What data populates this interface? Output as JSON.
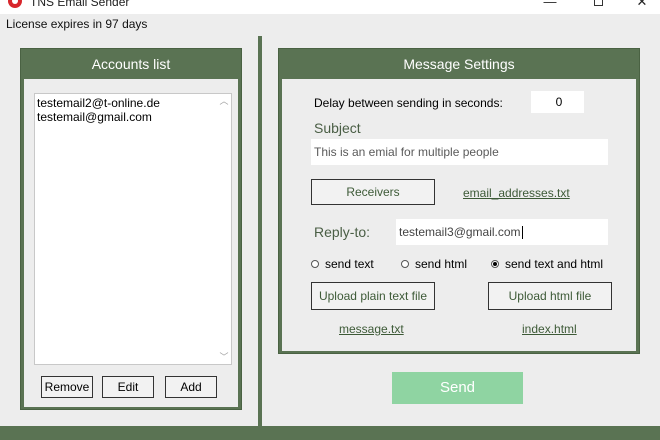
{
  "window": {
    "title": "TNS Email Sender",
    "minimize": "—",
    "close": "✕"
  },
  "license_text": "License expires in 97 days",
  "accounts": {
    "header": "Accounts list",
    "items": [
      "testemail2@t-online.de",
      "testemail@gmail.com"
    ],
    "buttons": {
      "remove": "Remove",
      "edit": "Edit",
      "add": "Add"
    }
  },
  "message": {
    "header": "Message Settings",
    "delay_label": "Delay between sending in seconds:",
    "delay_value": "0",
    "subject_label": "Subject",
    "subject_value": "This is an emial for multiple people",
    "receivers_button": "Receivers",
    "receivers_file": "email_addresses.txt",
    "replyto_label": "Reply-to:",
    "replyto_value": "testemail3@gmail.com",
    "send_options": [
      {
        "label": "send text",
        "selected": false
      },
      {
        "label": "send html",
        "selected": false
      },
      {
        "label": "send text and html",
        "selected": true
      }
    ],
    "upload_plain_button": "Upload plain text file",
    "upload_html_button": "Upload html file",
    "plain_file": "message.txt",
    "html_file": "index.html"
  },
  "send_button": "Send",
  "colors": {
    "panel_green": "#5a7353",
    "send_button": "#8fd4a2",
    "status_text": "#f2e12a"
  }
}
